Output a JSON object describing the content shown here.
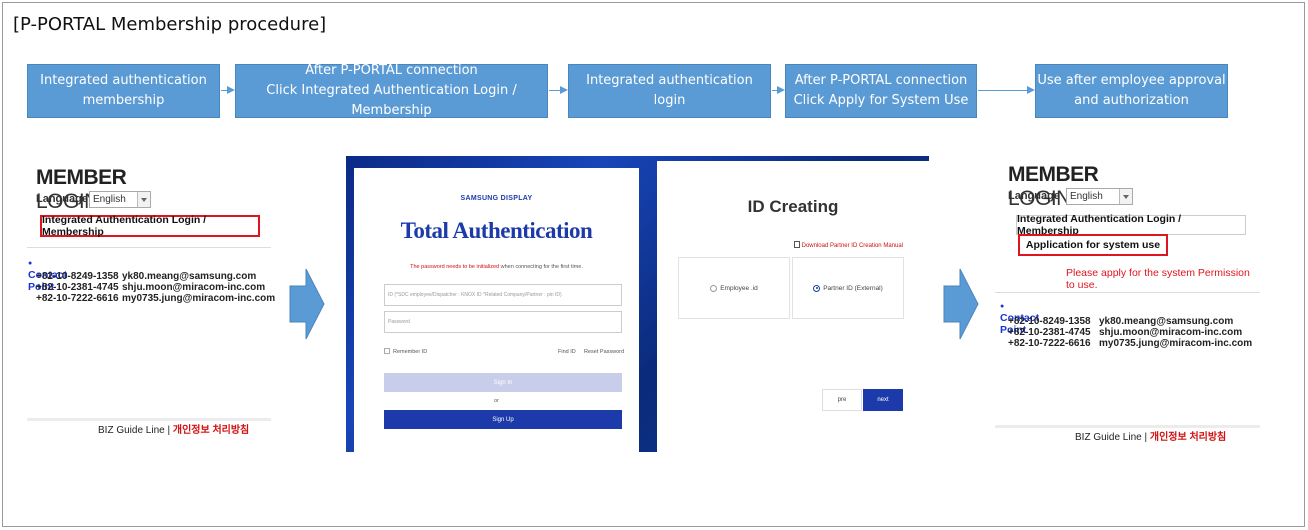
{
  "title": "[P-PORTAL Membership procedure]",
  "steps": [
    "Integrated authentication\nmembership",
    "After P-PORTAL connection\nClick Integrated Authentication Login / Membership",
    "Integrated authentication login",
    "After P-PORTAL connection\nClick Apply for System Use",
    "Use after employee approval\nand authorization"
  ],
  "login": {
    "member": "MEMBER",
    "login": "LOGIN",
    "language_label": "Language",
    "language_value": "English",
    "integrated_button": "Integrated Authentication Login / Membership",
    "application_button": "Application for system use",
    "permission_note": "Please apply for the system Permission to use.",
    "contact_title": "Contact Point",
    "contacts": [
      {
        "phone": "+82-10-8249-1358",
        "email": "yk80.meang@samsung.com"
      },
      {
        "phone": "+82-10-2381-4745",
        "email": "shju.moon@miracom-inc.com"
      },
      {
        "phone": "+82-10-7222-6616",
        "email": "my0735.jung@miracom-inc.com"
      }
    ],
    "biz_guide": "BIZ Guide Line |",
    "privacy": "개인정보 처리방침"
  },
  "auth": {
    "brand": "SAMSUNG DISPLAY",
    "title": "Total Authentication",
    "note_red": "The password needs to be initialized",
    "note_rest": " when connecting for the first time.",
    "id_placeholder": "ID (*SDC employee/Dispatcher : KNOX ID  *Related Company/Partner : pin ID)",
    "password_placeholder": "Password",
    "remember": "Remember ID",
    "find_id": "Find ID",
    "reset_password": "Reset Password",
    "sign_in": "Sign In",
    "or": "or",
    "sign_up": "Sign Up"
  },
  "id_creating": {
    "title": "ID Creating",
    "download": "Download Partner ID Creation Manual",
    "employee": "Employee .id",
    "partner": "Partner ID (External)",
    "prev": "pre",
    "next": "next"
  },
  "colors": {
    "step_blue": "#5b9bd5",
    "highlight_red": "#e0141e",
    "contact_blue": "#1a35d6",
    "auth_blue": "#1c3aa9"
  }
}
